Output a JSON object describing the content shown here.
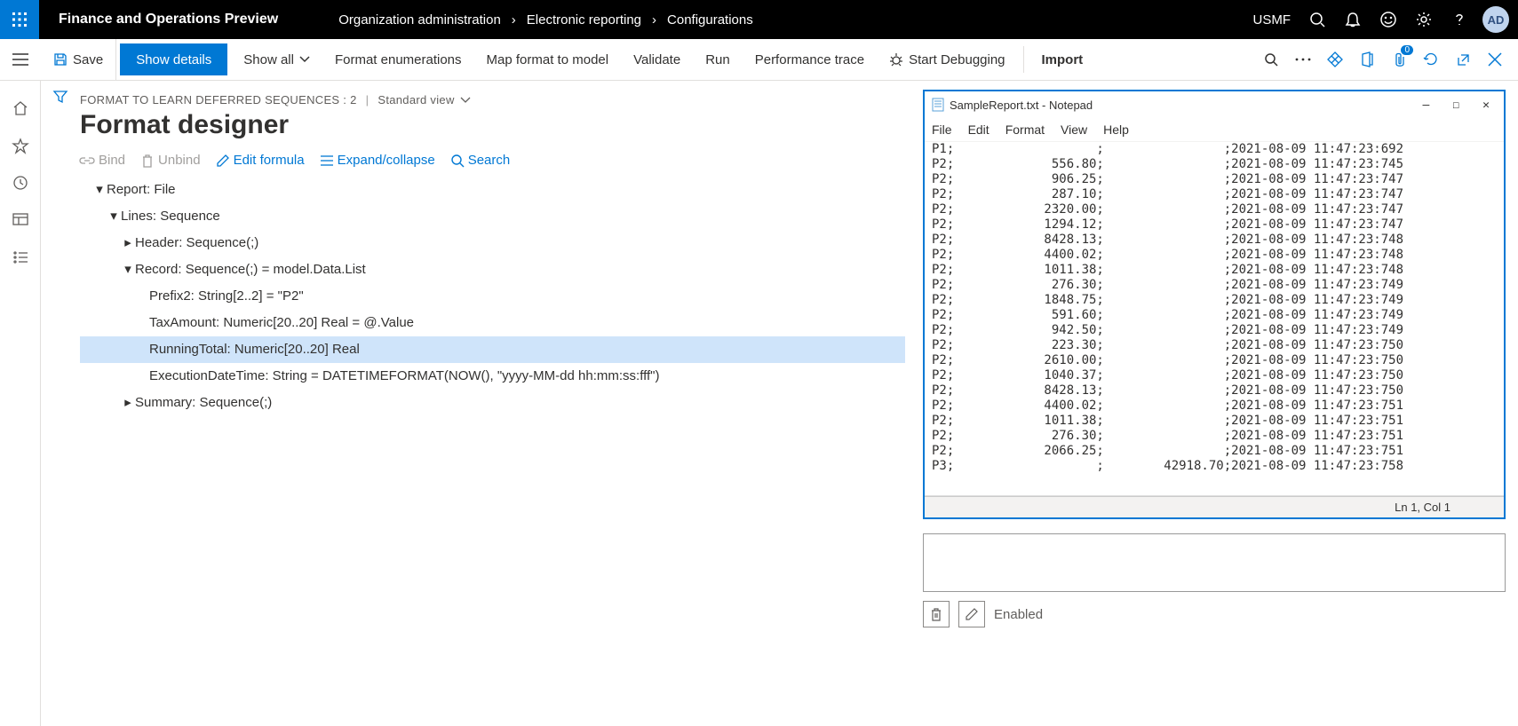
{
  "topbar": {
    "app_title": "Finance and Operations Preview",
    "crumbs": [
      "Organization administration",
      "Electronic reporting",
      "Configurations"
    ],
    "entity": "USMF",
    "avatar": "AD"
  },
  "cmdbar": {
    "save": "Save",
    "show_details": "Show details",
    "show_all": "Show all",
    "format_enum": "Format enumerations",
    "map_format": "Map format to model",
    "validate": "Validate",
    "run": "Run",
    "perf_trace": "Performance trace",
    "start_debug": "Start Debugging",
    "import": "Import",
    "attach_count": "0"
  },
  "designer": {
    "crumb_label": "FORMAT TO LEARN DEFERRED SEQUENCES : 2",
    "view_label": "Standard view",
    "title": "Format designer",
    "toolbar": {
      "bind": "Bind",
      "unbind": "Unbind",
      "edit_formula": "Edit formula",
      "expand": "Expand/collapse",
      "search": "Search"
    },
    "tree": {
      "n0": "Report: File",
      "n1": "Lines: Sequence",
      "n2": "Header: Sequence(;)",
      "n3": "Record: Sequence(;) = model.Data.List",
      "n4": "Prefix2: String[2..2] = \"P2\"",
      "n5": "TaxAmount: Numeric[20..20] Real = @.Value",
      "n6": "RunningTotal: Numeric[20..20] Real",
      "n7": "ExecutionDateTime: String = DATETIMEFORMAT(NOW(), \"yyyy-MM-dd hh:mm:ss:fff\")",
      "n8": "Summary: Sequence(;)"
    }
  },
  "notepad": {
    "title": "SampleReport.txt - Notepad",
    "menu": [
      "File",
      "Edit",
      "Format",
      "View",
      "Help"
    ],
    "status": "Ln 1, Col 1",
    "rows": [
      {
        "p": "P1;",
        "v": ";",
        "t": ";2021-08-09 11:47:23:692"
      },
      {
        "p": "P2;",
        "v": "556.80;",
        "t": ";2021-08-09 11:47:23:745"
      },
      {
        "p": "P2;",
        "v": "906.25;",
        "t": ";2021-08-09 11:47:23:747"
      },
      {
        "p": "P2;",
        "v": "287.10;",
        "t": ";2021-08-09 11:47:23:747"
      },
      {
        "p": "P2;",
        "v": "2320.00;",
        "t": ";2021-08-09 11:47:23:747"
      },
      {
        "p": "P2;",
        "v": "1294.12;",
        "t": ";2021-08-09 11:47:23:747"
      },
      {
        "p": "P2;",
        "v": "8428.13;",
        "t": ";2021-08-09 11:47:23:748"
      },
      {
        "p": "P2;",
        "v": "4400.02;",
        "t": ";2021-08-09 11:47:23:748"
      },
      {
        "p": "P2;",
        "v": "1011.38;",
        "t": ";2021-08-09 11:47:23:748"
      },
      {
        "p": "P2;",
        "v": "276.30;",
        "t": ";2021-08-09 11:47:23:749"
      },
      {
        "p": "P2;",
        "v": "1848.75;",
        "t": ";2021-08-09 11:47:23:749"
      },
      {
        "p": "P2;",
        "v": "591.60;",
        "t": ";2021-08-09 11:47:23:749"
      },
      {
        "p": "P2;",
        "v": "942.50;",
        "t": ";2021-08-09 11:47:23:749"
      },
      {
        "p": "P2;",
        "v": "223.30;",
        "t": ";2021-08-09 11:47:23:750"
      },
      {
        "p": "P2;",
        "v": "2610.00;",
        "t": ";2021-08-09 11:47:23:750"
      },
      {
        "p": "P2;",
        "v": "1040.37;",
        "t": ";2021-08-09 11:47:23:750"
      },
      {
        "p": "P2;",
        "v": "8428.13;",
        "t": ";2021-08-09 11:47:23:750"
      },
      {
        "p": "P2;",
        "v": "4400.02;",
        "t": ";2021-08-09 11:47:23:751"
      },
      {
        "p": "P2;",
        "v": "1011.38;",
        "t": ";2021-08-09 11:47:23:751"
      },
      {
        "p": "P2;",
        "v": "276.30;",
        "t": ";2021-08-09 11:47:23:751"
      },
      {
        "p": "P2;",
        "v": "2066.25;",
        "t": ";2021-08-09 11:47:23:751"
      },
      {
        "p": "P3;",
        "v": ";",
        "t": "42918.70;2021-08-09 11:47:23:758"
      }
    ]
  },
  "bottom": {
    "enabled": "Enabled"
  }
}
